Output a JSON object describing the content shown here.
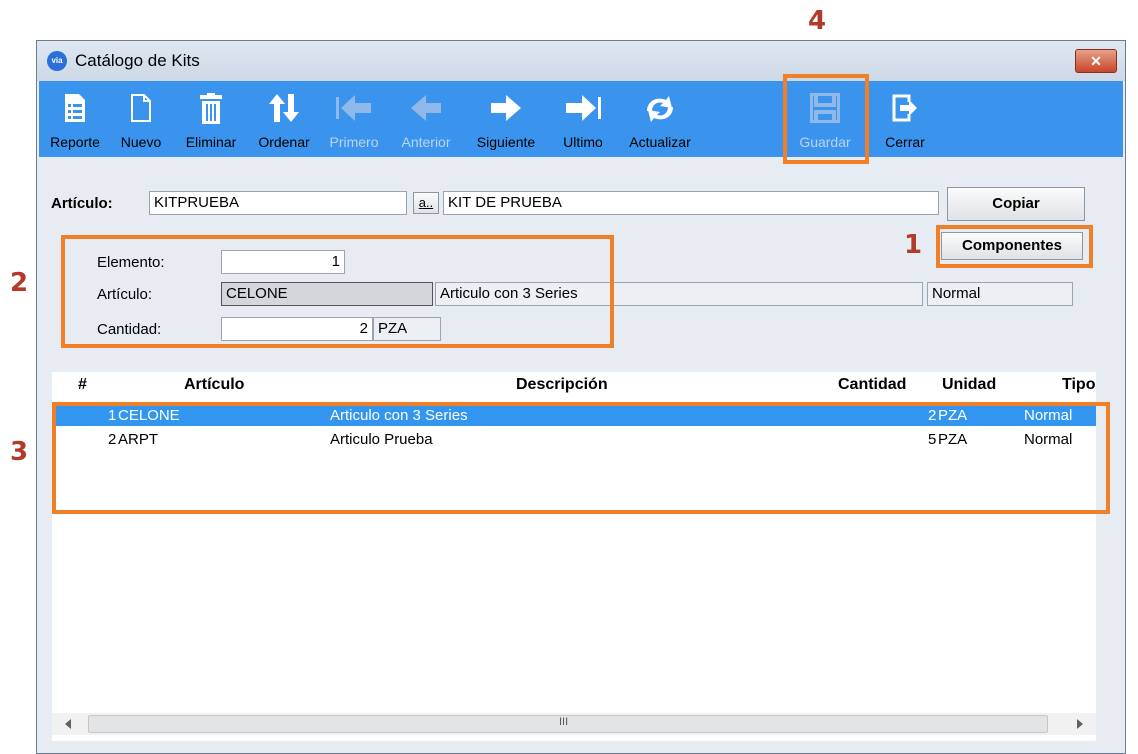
{
  "window": {
    "title": "Catálogo de Kits",
    "close_label": "✕",
    "app_icon_text": "via"
  },
  "toolbar": {
    "buttons": [
      {
        "label": "Reporte",
        "icon": "report-icon",
        "enabled": true
      },
      {
        "label": "Nuevo",
        "icon": "new-document-icon",
        "enabled": true
      },
      {
        "label": "Eliminar",
        "icon": "trash-icon",
        "enabled": true
      },
      {
        "label": "Ordenar",
        "icon": "sort-arrows-icon",
        "enabled": true
      },
      {
        "label": "Primero",
        "icon": "first-arrow-icon",
        "enabled": false
      },
      {
        "label": "Anterior",
        "icon": "previous-arrow-icon",
        "enabled": false
      },
      {
        "label": "Siguiente",
        "icon": "next-arrow-icon",
        "enabled": true
      },
      {
        "label": "Ultimo",
        "icon": "last-arrow-icon",
        "enabled": true
      },
      {
        "label": "Actualizar",
        "icon": "refresh-icon",
        "enabled": true
      },
      {
        "label": "Guardar",
        "icon": "save-icon",
        "enabled": false
      },
      {
        "label": "Cerrar",
        "icon": "exit-icon",
        "enabled": true
      }
    ]
  },
  "header_form": {
    "articulo_label": "Artículo:",
    "articulo_value": "KITPRUEBA",
    "lookup_label": "a..",
    "descripcion_value": "KIT DE PRUEBA",
    "copiar_label": "Copiar",
    "componentes_label": "Componentes"
  },
  "detail_form": {
    "elemento_label": "Elemento:",
    "elemento_value": "1",
    "articulo_label": "Artículo:",
    "articulo_value": "CELONE",
    "articulo_desc": "Articulo con 3 Series",
    "tipo_value": "Normal",
    "cantidad_label": "Cantidad:",
    "cantidad_value": "2",
    "unidad_value": "PZA"
  },
  "grid": {
    "columns": [
      "#",
      "Artículo",
      "Descripción",
      "Cantidad",
      "Unidad",
      "Tipo"
    ],
    "rows": [
      {
        "num": "1",
        "articulo": "CELONE",
        "descripcion": "Articulo con 3 Series",
        "cantidad": "2",
        "unidad": "PZA",
        "tipo": "Normal",
        "selected": true
      },
      {
        "num": "2",
        "articulo": "ARPT",
        "descripcion": "Articulo Prueba",
        "cantidad": "5",
        "unidad": "PZA",
        "tipo": "Normal",
        "selected": false
      }
    ],
    "scroll_grip": "III"
  },
  "annotations": {
    "n1": "1",
    "n2": "2",
    "n3": "3",
    "n4": "4"
  },
  "colors": {
    "toolbar": "#3a94ee",
    "highlight": "#f07f27",
    "selected_row": "#3296f0",
    "annotation_text": "#b23a2a"
  }
}
